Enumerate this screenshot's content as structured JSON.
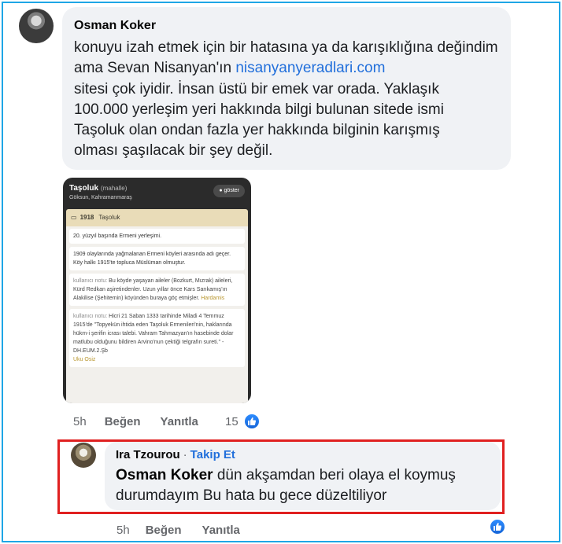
{
  "comment_1": {
    "author": "Osman Koker",
    "text_before_link": "konuyu izah etmek için bir hatasına ya da karışıklığına değindim ama Sevan Nisanyan'ın ",
    "link": "nisanyanyeradlari.com",
    "text_after_link": "\nsitesi çok iyidir. İnsan üstü bir emek var orada. Yaklaşık\n100.000 yerleşim yeri hakkında bilgi bulunan sitede ismi\nTaşoluk olan ondan fazla yer hakkında bilginin karışmış\nolması şaşılacak bir şey değil.",
    "time": "5h",
    "like_label": "Beğen",
    "reply_label": "Yanıtla",
    "reaction_count": "15"
  },
  "embedded_screenshot": {
    "title": "Taşoluk",
    "title_tag": "(mahalle)",
    "subtitle": "Göksun, Kahramanmaraş",
    "button_label": "göster",
    "year": "1918",
    "year_name": "Taşoluk",
    "card_1": "20. yüzyıl başında Ermeni yerleşimi.",
    "card_2": "1909 olaylarında yağmalanan Ermeni köyleri arasında adı geçer. Köy halkı 1915'te topluca Müslüman olmuştur.",
    "note_1_user": "kullanıcı notu:",
    "note_1_text": " Bu köyde yaşayan aileler (Bozkurt, Mızrak) aileleri, Kürd Redkan aşiretindenler. Uzun yıllar önce Kars Sarıkamış'ın Alakilise (Şehitemin) köyünden buraya göç etmişler. ",
    "note_1_author": "Hardamis",
    "note_2_user": "kullanıcı notu:",
    "note_2_text": " Hicri 21 Saban 1333 tarihinde Miladi 4 Temmuz 1915'de \"Topyekün ihtida eden Taşoluk Ermenileri'nin, haklarında hükm-i şerifin icrası talebi. Vahram Tahmazyan'ın hasebinde dolar matlubu olduğunu bildiren Arvino'nun çektiği telgrafın sureti.\" - DH.EUM.2.Şb",
    "note_2_author": "Uku Osiz"
  },
  "comment_2": {
    "author": "Ira Tzourou",
    "separator": "·",
    "follow_label": "Takip Et",
    "mention": "Osman Koker",
    "text": " dün akşamdan beri olaya el koymuş durumdayım Bu hata bu gece düzeltiliyor",
    "time": "5h",
    "like_label": "Beğen",
    "reply_label": "Yanıtla"
  },
  "colors": {
    "highlight_border": "#e02020",
    "frame_border": "#1ea6e6",
    "link": "#216fdb",
    "bubble": "#f0f2f5"
  }
}
